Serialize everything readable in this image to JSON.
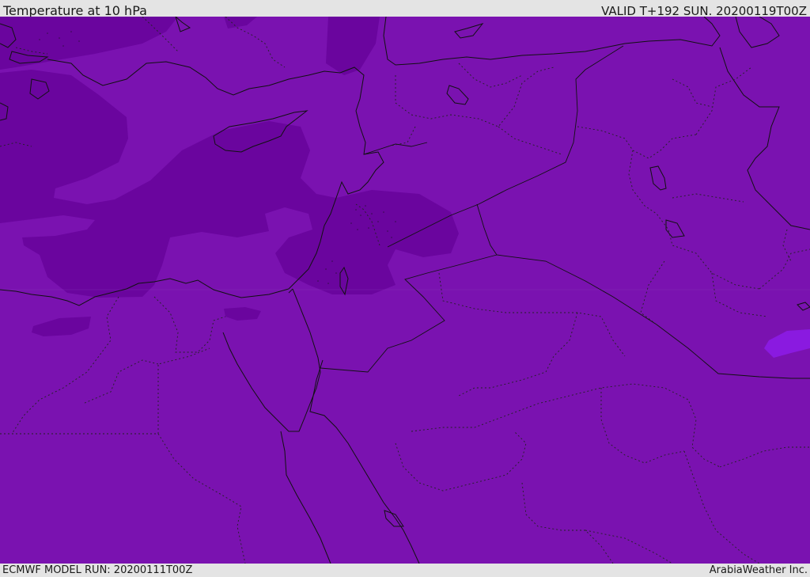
{
  "header": {
    "title": "Temperature at 10 hPa",
    "valid": "VALID T+192 SUN. 20200119T00Z"
  },
  "footer": {
    "model_run": "ECMWF MODEL RUN: 20200111T00Z",
    "brand": "ArabiaWeather Inc."
  },
  "map": {
    "colors": {
      "base": "#7a12b0",
      "darker": "#6a059e",
      "lighter": "#8a1ae0",
      "land_border": "#111111"
    }
  }
}
